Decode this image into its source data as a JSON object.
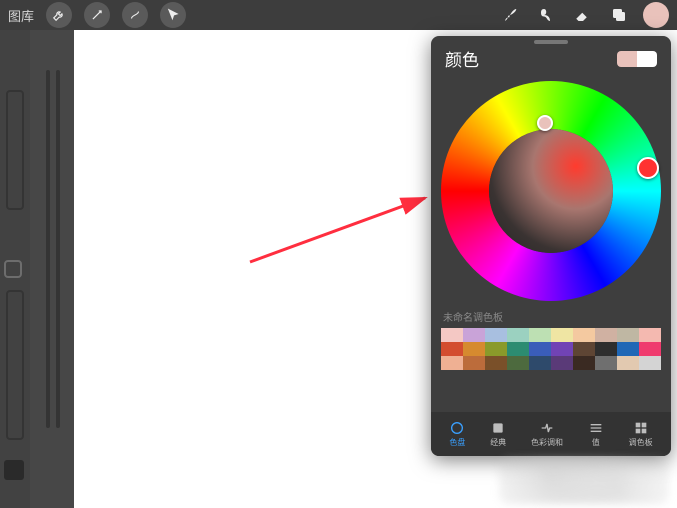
{
  "topbar": {
    "library_label": "图库",
    "tools": [
      "wrench",
      "wand",
      "s-curve",
      "arrow"
    ],
    "right": [
      "brush",
      "smudge",
      "eraser",
      "layers"
    ],
    "active_color": "#e9c2bb"
  },
  "popover": {
    "title": "颜色",
    "current_color": "#e9c2bb",
    "compare_color": "#ffffff",
    "history_label": "未命名调色板",
    "swatches_row1": [
      "#f4c8c4",
      "#c9a3d8",
      "#a8bfe0",
      "#9bd1c0",
      "#bde0b3",
      "#efe5a3",
      "#f4c9a0",
      "#d0b1a2",
      "#bfb7a3",
      "#f4b9b0"
    ],
    "swatches_row2": [
      "#d34d2f",
      "#d68a2f",
      "#8a9a2a",
      "#2c8c71",
      "#3a5db9",
      "#7143b5",
      "#5e4534",
      "#2e2e2e",
      "#1f67b6",
      "#ef3b6e"
    ],
    "swatches_row3": [
      "#efb093",
      "#bc6c3b",
      "#7a5029",
      "#4d6a3e",
      "#2e4a6b",
      "#5a3a78",
      "#3a2a22",
      "#6f6f6f",
      "#e2c9b0",
      "#d4d4d4"
    ],
    "tabs": [
      {
        "label": "色盘",
        "active": true
      },
      {
        "label": "经典",
        "active": false
      },
      {
        "label": "色彩调和",
        "active": false
      },
      {
        "label": "值",
        "active": false
      },
      {
        "label": "调色板",
        "active": false
      }
    ]
  }
}
